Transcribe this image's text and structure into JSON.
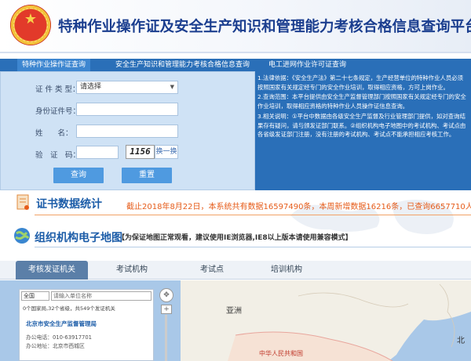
{
  "header": {
    "title": "特种作业操作证及安全生产知识和管理能力考核合格信息查询平台"
  },
  "query_tabs": [
    {
      "label": "特种作业操作证查询",
      "active": true
    },
    {
      "label": "安全生产知识和管理能力考核合格信息查询",
      "active": false
    },
    {
      "label": "电工进网作业许可证查询",
      "active": false
    }
  ],
  "form": {
    "cert_type_label": "证 件 类 型：",
    "cert_type_value": "请选择",
    "id_label": "身份证件号：",
    "name_label": "姓　　名：",
    "captcha_label": "验　证　码：",
    "captcha_text": "1156",
    "refresh_label": "换一换",
    "query_button": "查询",
    "reset_button": "重置"
  },
  "notice": [
    "1.法律依据：《安全生产法》第二十七条规定，生产经营单位的特种作业人员必须按照国家有关规定经专门的安全作业培训，取得相应资格，方可上岗作业。",
    "2.查询范围：本平台提供由安全生产监督管理部门按照国家有关规定经专门的安全作业培训，取得相应资格的特种作业人员操作证信息查询。",
    "3.相关说明：①平台中数据由各级安全生产监督及行业管理部门提供，如对查询结果存有疑问，请与颁发证部门联系。②组织机构电子地图中的考试机构、考试点由各省级发证部门注册，没有注册的考试机构、考试点不能承担相应考核工作。"
  ],
  "stats": {
    "title": "证书数据统计",
    "text": "截止2018年8月22日，本系统共有数据16597490条，本周新增数据16216条，已查询6657710人。"
  },
  "map_section": {
    "title": "组织机构电子地图",
    "note": "【为保证地图正常观看，建议使用IE浏览器,IE8以上版本请使用兼容模式】",
    "tabs": [
      {
        "label": "考核发证机关",
        "active": true
      },
      {
        "label": "考试机构",
        "active": false
      },
      {
        "label": "考试点",
        "active": false
      },
      {
        "label": "培训机构",
        "active": false
      }
    ],
    "search": {
      "scope": "全国",
      "placeholder": "请输入单位名称",
      "count": "0个国家局,32个省级，共549个发证机关",
      "org_name": "北京市安全生产监督管理局",
      "phone": "办公电话：010-63917701",
      "address": "办公地址：北京市西城区"
    },
    "map_labels": {
      "asia": "亚洲",
      "china": "中华人民共和国",
      "north": "北"
    }
  },
  "colors": {
    "brand_blue": "#2a6fb8",
    "title_blue": "#1b3e8f",
    "stats_orange": "#e65c1a"
  }
}
